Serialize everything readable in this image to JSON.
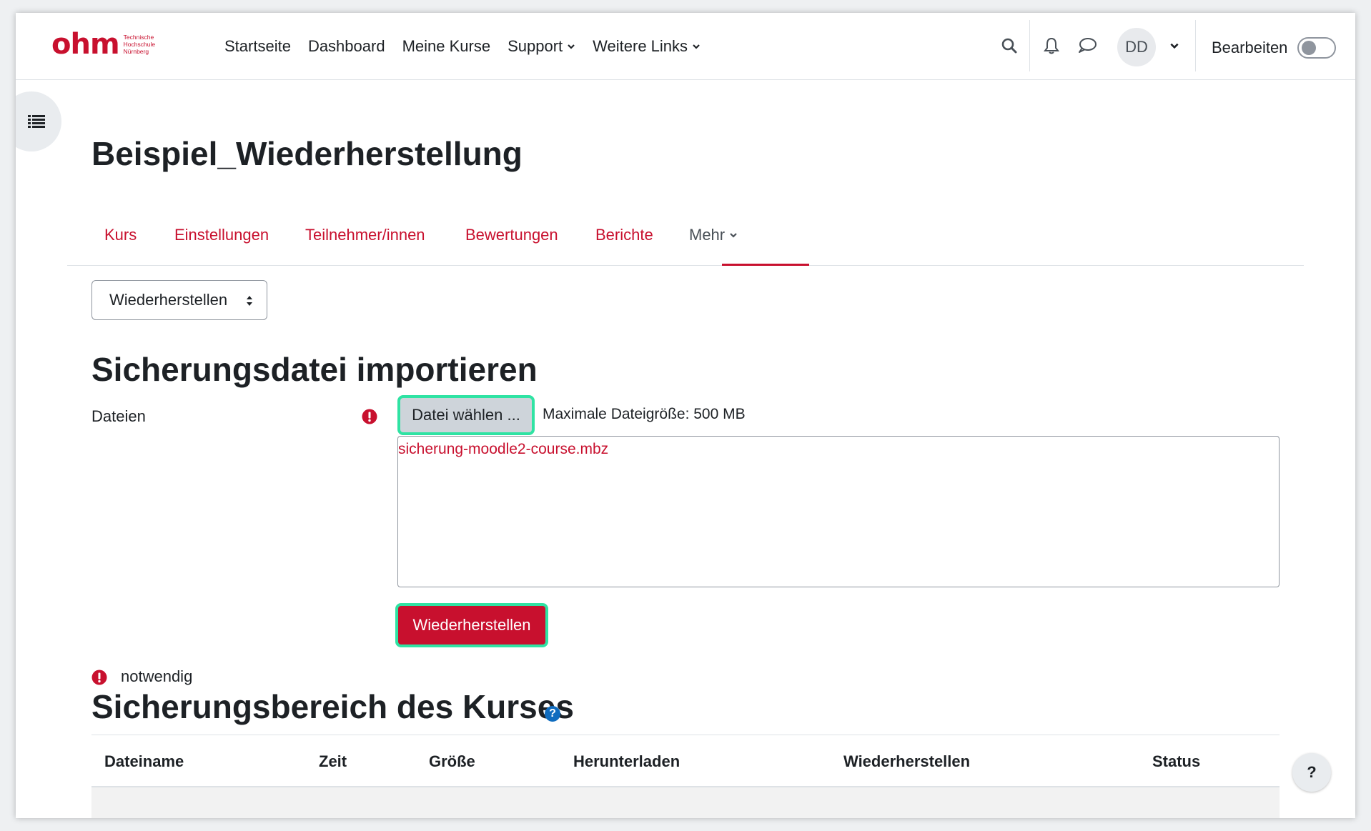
{
  "brand": {
    "logo_text": "ohm",
    "logo_sub": [
      "Technische",
      "Hochschule",
      "Nürnberg"
    ],
    "accent_color": "#c8102e",
    "highlight_color": "#2fe3a3"
  },
  "navbar": {
    "links": [
      "Startseite",
      "Dashboard",
      "Meine Kurse",
      "Support",
      "Weitere Links"
    ],
    "avatar_initials": "DD",
    "edit_label": "Bearbeiten",
    "edit_mode_on": false,
    "icons": [
      "search-icon",
      "bell-icon",
      "chat-icon",
      "chevron-down-icon"
    ]
  },
  "page": {
    "title": "Beispiel_Wiederherstellung",
    "tabs": [
      "Kurs",
      "Einstellungen",
      "Teilnehmer/innen",
      "Bewertungen",
      "Berichte",
      "Mehr"
    ],
    "active_tab": "Mehr"
  },
  "action_select": {
    "value": "Wiederherstellen"
  },
  "import_section": {
    "heading": "Sicherungsdatei importieren",
    "files_label": "Dateien",
    "choose_file_button": "Datei wählen ...",
    "max_size_text": "Maximale Dateigröße: 500 MB",
    "selected_file": "sicherung-moodle2-course.mbz",
    "restore_button": "Wiederherstellen",
    "required_note": "notwendig"
  },
  "backup_area": {
    "heading": "Sicherungsbereich des Kurses",
    "columns": [
      "Dateiname",
      "Zeit",
      "Größe",
      "Herunterladen",
      "Wiederherstellen",
      "Status"
    ]
  },
  "help_button": "?"
}
